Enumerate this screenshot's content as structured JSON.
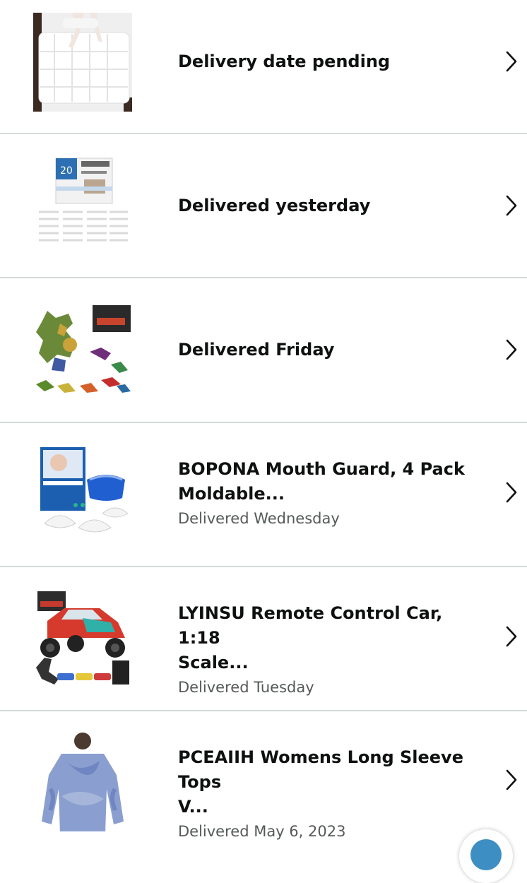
{
  "orders": [
    {
      "title": "",
      "status": "Delivery date pending",
      "image": "mattress-topper"
    },
    {
      "title": "",
      "status": "Delivered yesterday",
      "image": "cabinet-locks"
    },
    {
      "title": "",
      "status": "Delivered Friday",
      "image": "robot-dinosaur-toy"
    },
    {
      "title_line1": "BOPONA Mouth Guard, 4 Pack",
      "title_line2": "Moldable...",
      "status": "Delivered Wednesday",
      "image": "mouth-guard"
    },
    {
      "title_line1": "LYINSU Remote Control Car, 1:18",
      "title_line2": "Scale...",
      "status": "Delivered Tuesday",
      "image": "rc-car"
    },
    {
      "title_line1": "PCEAIIH Womens Long Sleeve Tops",
      "title_line2": "V...",
      "status": "Delivered May 6, 2023",
      "image": "tie-dye-top"
    }
  ],
  "icons": {
    "chevron": "chevron-right-icon"
  },
  "colors": {
    "divider": "#d5d9d9",
    "title": "#0f1111",
    "status": "#565959",
    "accent": "#3d8fc3"
  }
}
